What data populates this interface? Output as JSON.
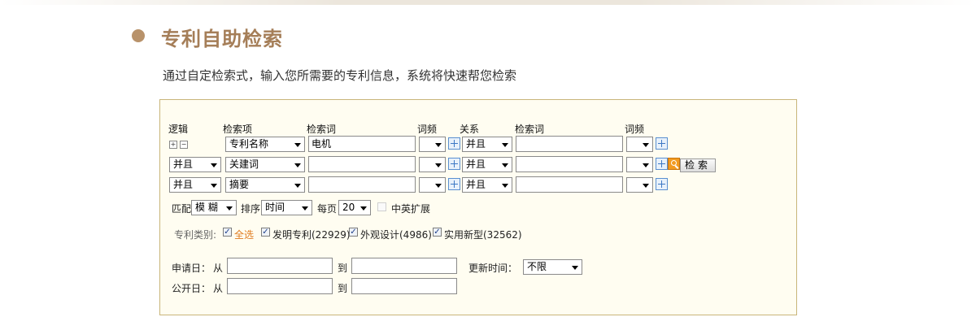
{
  "header": {
    "title": "专利自助检索",
    "subtitle": "通过自定检索式，输入您所需要的专利信息，系统将快速帮您检索"
  },
  "form": {
    "headers": {
      "logic": "逻辑",
      "field": "检索项",
      "term": "检索词",
      "freq": "词频",
      "relation": "关系",
      "term2": "检索词",
      "freq2": "词频"
    },
    "add_symbol": "+",
    "remove_symbol": "−",
    "rows": [
      {
        "logic": "",
        "field": "专利名称",
        "term": "电机",
        "freq": "",
        "relation": "并且",
        "term2": "",
        "freq2": ""
      },
      {
        "logic": "并且",
        "field": "关建词",
        "term": "",
        "freq": "",
        "relation": "并且",
        "term2": "",
        "freq2": ""
      },
      {
        "logic": "并且",
        "field": "摘要",
        "term": "",
        "freq": "",
        "relation": "并且",
        "term2": "",
        "freq2": ""
      }
    ],
    "search_button": "检索",
    "match_label": "匹配",
    "match_value": "模 糊",
    "sort_label": "排序",
    "sort_value": "时间",
    "per_page_label": "每页",
    "per_page_value": "20",
    "cn_en_label": "中英扩展",
    "category_label": "专利类别:",
    "categories": [
      {
        "label": "全选",
        "checked": true
      },
      {
        "label": "发明专利(22929)",
        "checked": true
      },
      {
        "label": "外观设计(4986)",
        "checked": true
      },
      {
        "label": "实用新型(32562)",
        "checked": true
      }
    ],
    "apply_date_label": "申请日：",
    "publish_date_label": "公开日：",
    "from_label": "从",
    "to_label": "到",
    "update_time_label": "更新时间：",
    "update_time_value": "不限"
  },
  "colors": {
    "title": "#a57e58",
    "bullet": "#b8926a",
    "panel_border": "#c9b57a",
    "panel_bg": "#fffdf1",
    "select_all": "#e07b1f"
  },
  "icons": [
    "add-icon",
    "remove-icon",
    "dictionary-icon",
    "magnifier-icon",
    "dropdown-arrow-icon"
  ]
}
